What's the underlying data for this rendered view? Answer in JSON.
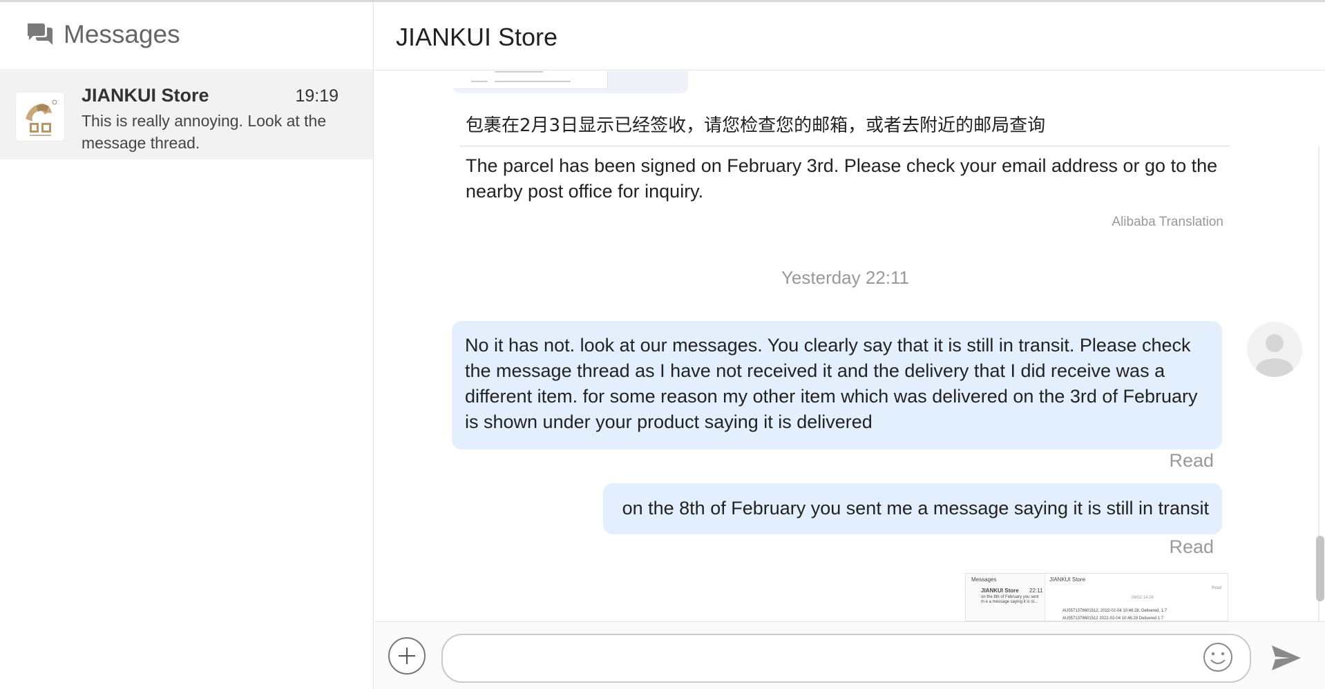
{
  "sidebar": {
    "title": "Messages",
    "conversations": [
      {
        "name": "JIANKUI Store",
        "time": "19:19",
        "preview": "This is really annoying. Look at the message thread."
      }
    ]
  },
  "chat": {
    "title": "JIANKUI Store",
    "translated_message": {
      "original": "包裹在2月3日显示已经签收，请您检查您的邮箱，或者去附近的邮局查询",
      "translation": "The parcel has been signed on February 3rd. Please check your email address or go to the nearby post office for inquiry.",
      "credit": "Alibaba Translation"
    },
    "timestamp": "Yesterday 22:11",
    "sent_messages": [
      {
        "text": "No it has not. look at our messages. You clearly say that it is still in transit. Please check the message thread as I have not received it and the delivery that I did receive was a different item. for some reason my other item which was delivered on the 3rd of February is shown under your product saying it is delivered",
        "status": "Read"
      },
      {
        "text": "on the 8th of February you sent me a message saying it is still in transit",
        "status": "Read"
      }
    ],
    "screenshot_preview": {
      "sidebar_title": "Messages",
      "store_name": "JIANKUI Store",
      "store_time": "22:11",
      "store_preview": "on the 8th of February you sent m e a message saying it is st...",
      "chat_title": "JIANKUI Store",
      "timestamp": "08/02 14:28",
      "status": "Read",
      "line1": "AU5571378601512, 2022-02-04 10:46:28, Delivered, 1:7",
      "line2": "AU5571378601512 2022-02-04 10:46:28 Delivered 1:7"
    }
  },
  "composer": {
    "placeholder": ""
  },
  "icons": {
    "messages": "chat-bubbles-icon",
    "add": "plus-circle-icon",
    "emoji": "smiley-icon",
    "send": "paper-plane-icon",
    "user": "user-avatar-icon"
  }
}
